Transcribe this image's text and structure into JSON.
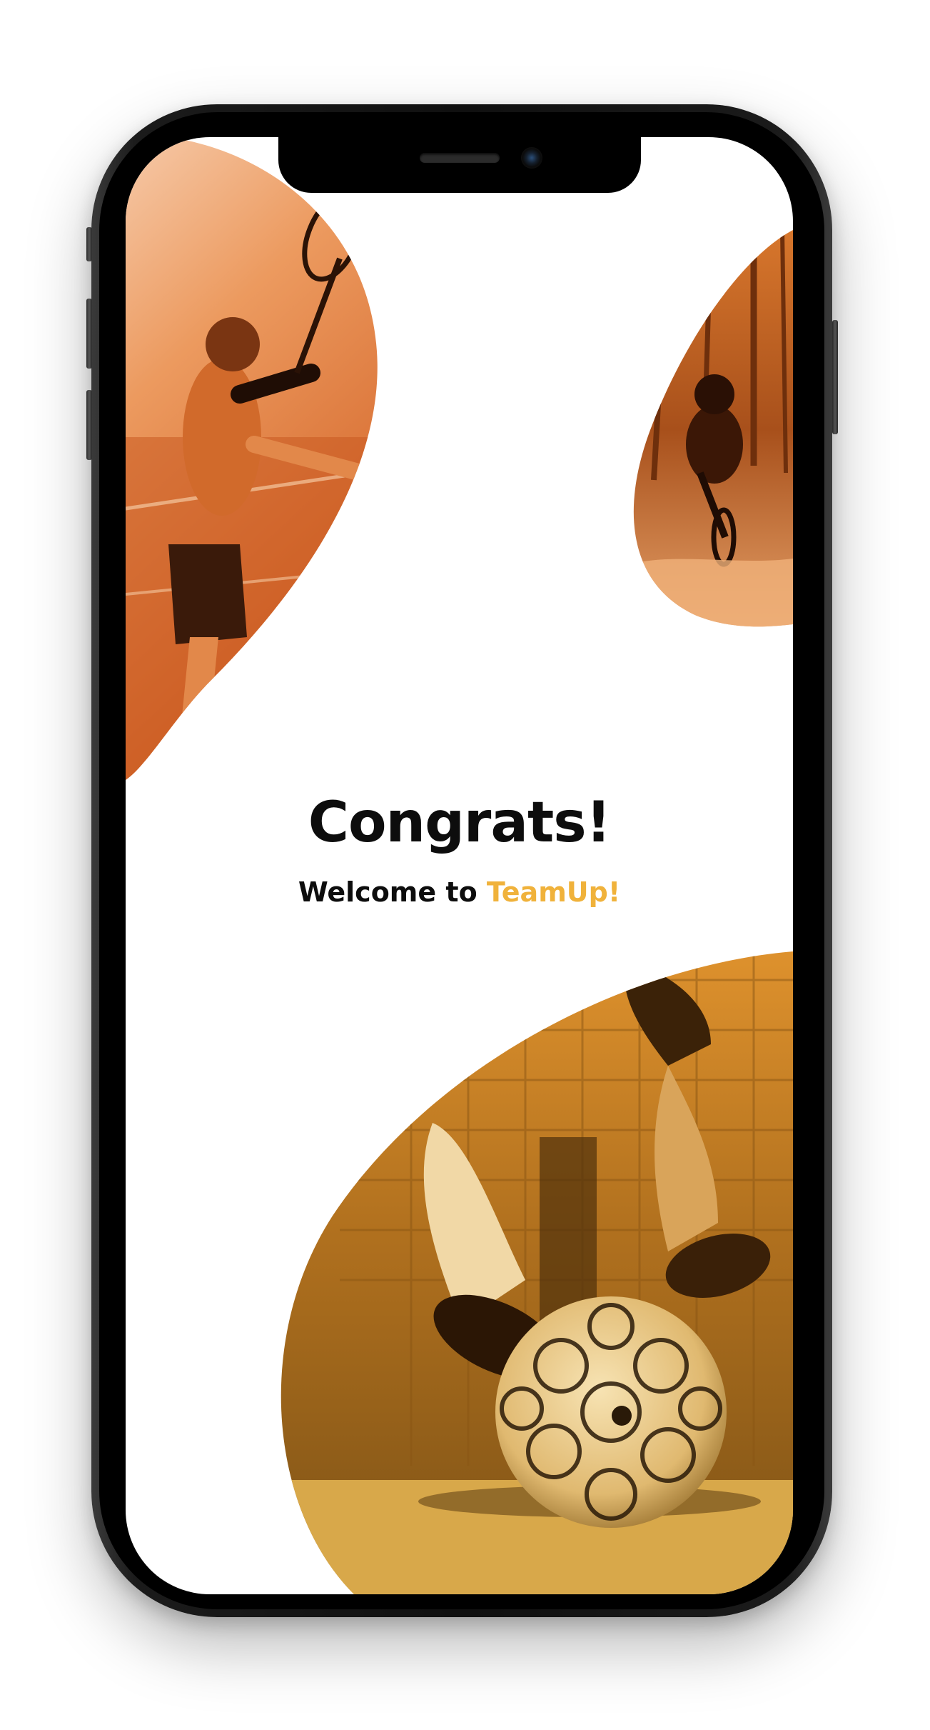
{
  "screen": {
    "headline": "Congrats!",
    "welcome_prefix": "Welcome to",
    "brand_name": "TeamUp!"
  },
  "images": {
    "top_left": "tennis-player-photo",
    "top_right": "mountain-biker-photo",
    "bottom": "soccer-ball-photo"
  },
  "colors": {
    "accent": "#f0b23b",
    "photo_tint_orange": "#e8752a",
    "photo_tint_gold": "#d9a23a",
    "text": "#0d0d0d",
    "background": "#ffffff"
  }
}
